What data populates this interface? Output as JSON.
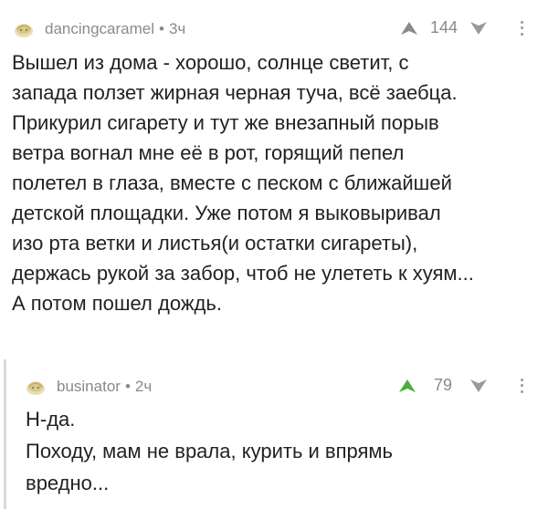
{
  "comments": [
    {
      "username": "dancingcaramel",
      "separator": "•",
      "time": "3ч",
      "score": "144",
      "score_color": "#8a8a8a",
      "lines": [
        "Вышел из дома - хорошо, солнце светит, с",
        "запада ползет жирная черная туча, всё заебца.",
        "Прикурил сигарету и тут же внезапный порыв",
        "ветра вогнал мне её в рот, горящий пепел",
        "полетел в глаза, вместе с песком с ближайшей",
        "детской площадки. Уже потом я выковыривал",
        "изо рта ветки и листья(и остатки сигареты),",
        "держась рукой за забор, чтоб не улететь к хуям...",
        "А потом пошел дождь."
      ],
      "upvote_color": "#8a8a8a"
    },
    {
      "username": "businator",
      "separator": "•",
      "time": "2ч",
      "score": "79",
      "lines": [
        "Н-да.",
        "Походу, мам не врала, курить и впрямь",
        "вредно..."
      ],
      "upvote_color": "#4caf3d"
    }
  ],
  "icons": {
    "avatar": "default-avatar-icon",
    "upvote": "arrow-up-icon",
    "downvote": "arrow-down-icon",
    "more": "more-vertical-icon"
  }
}
